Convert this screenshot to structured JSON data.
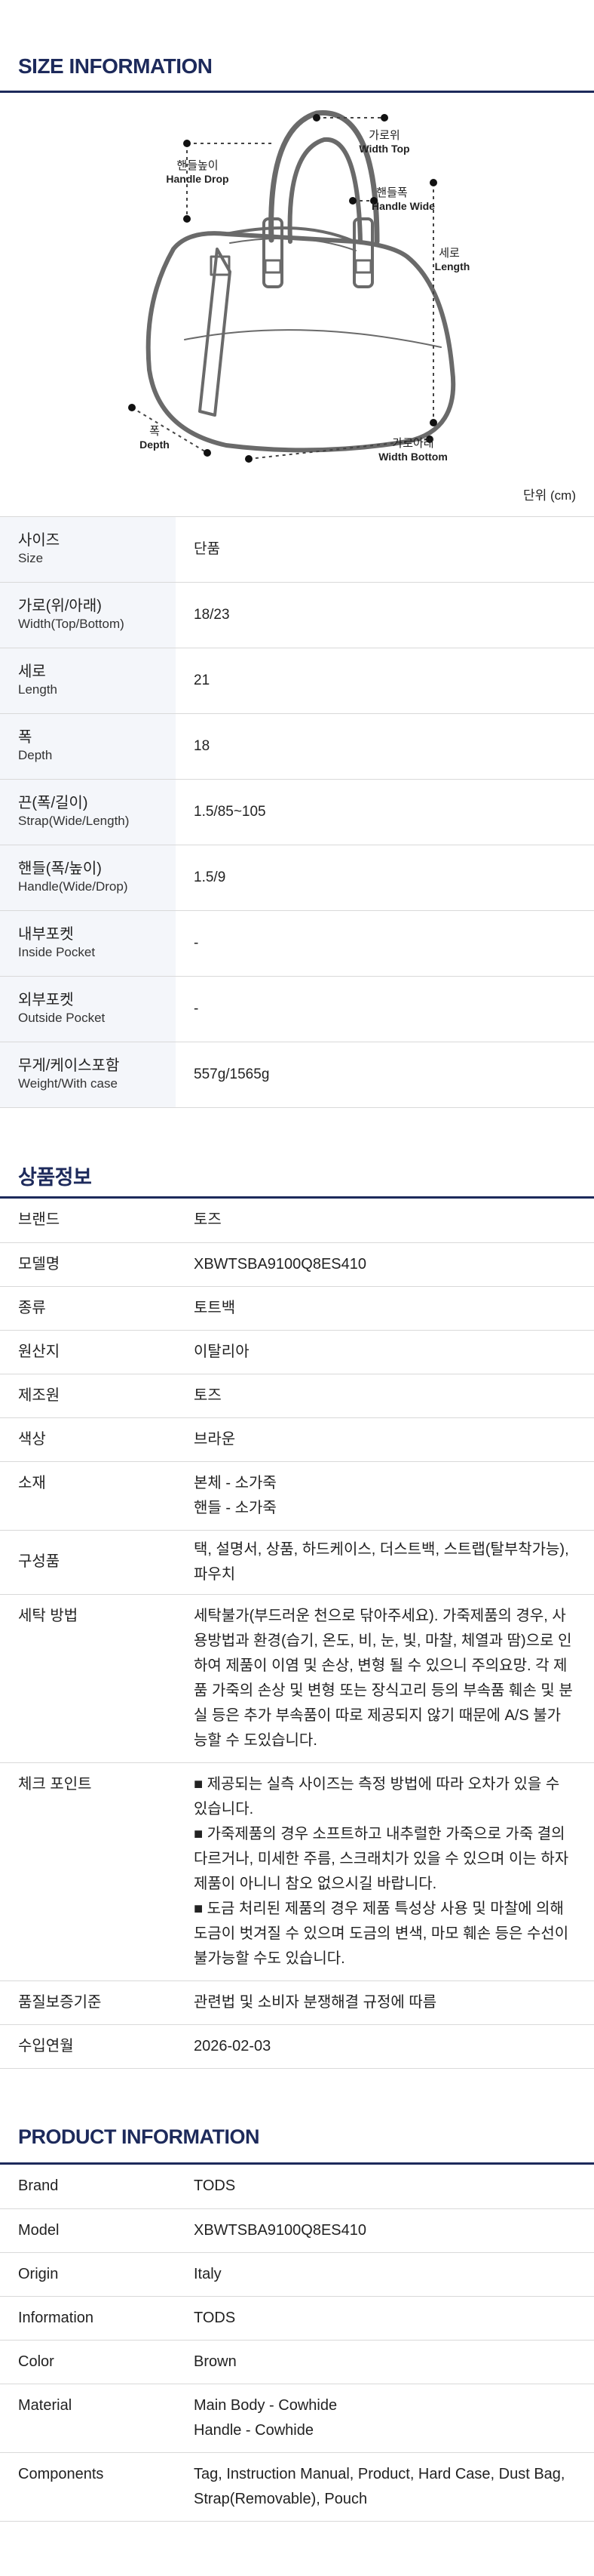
{
  "size_section": {
    "title": "SIZE INFORMATION",
    "unit": "단위 (cm)",
    "diagram_labels": {
      "handle_drop_ko": "핸들높이",
      "handle_drop_en": "Handle Drop",
      "width_top_ko": "가로위",
      "width_top_en": "Width Top",
      "handle_wide_ko": "핸들폭",
      "handle_wide_en": "Handle Wide",
      "length_ko": "세로",
      "length_en": "Length",
      "depth_ko": "폭",
      "depth_en": "Depth",
      "width_bottom_ko": "가로아래",
      "width_bottom_en": "Width Bottom"
    },
    "rows": [
      {
        "ko": "사이즈",
        "en": "Size",
        "value": "단품"
      },
      {
        "ko": "가로(위/아래)",
        "en": "Width(Top/Bottom)",
        "value": "18/23"
      },
      {
        "ko": "세로",
        "en": "Length",
        "value": "21"
      },
      {
        "ko": "폭",
        "en": "Depth",
        "value": "18"
      },
      {
        "ko": "끈(폭/길이)",
        "en": "Strap(Wide/Length)",
        "value": "1.5/85~105"
      },
      {
        "ko": "핸들(폭/높이)",
        "en": "Handle(Wide/Drop)",
        "value": "1.5/9"
      },
      {
        "ko": "내부포켓",
        "en": "Inside Pocket",
        "value": "-"
      },
      {
        "ko": "외부포켓",
        "en": "Outside Pocket",
        "value": "-"
      },
      {
        "ko": "무게/케이스포함",
        "en": "Weight/With case",
        "value": "557g/1565g"
      }
    ]
  },
  "product_ko": {
    "title": "상품정보",
    "rows": [
      {
        "label": "브랜드",
        "value": [
          "토즈"
        ]
      },
      {
        "label": "모델명",
        "value": [
          "XBWTSBA9100Q8ES410"
        ]
      },
      {
        "label": "종류",
        "value": [
          "토트백"
        ]
      },
      {
        "label": "원산지",
        "value": [
          "이탈리아"
        ]
      },
      {
        "label": "제조원",
        "value": [
          "토즈"
        ]
      },
      {
        "label": "색상",
        "value": [
          "브라운"
        ]
      },
      {
        "label": "소재",
        "value": [
          "본체 - 소가죽",
          "핸들 - 소가죽"
        ]
      },
      {
        "label": "구성품",
        "value": [
          "택, 설명서, 상품, 하드케이스, 더스트백, 스트랩(탈부착가능), 파우치"
        ]
      },
      {
        "label": "세탁 방법",
        "value": [
          "세탁불가(부드러운 천으로 닦아주세요). 가죽제품의 경우, 사용방법과 환경(습기, 온도, 비, 눈, 빛, 마찰, 체열과 땀)으로 인하여 제품이 이염 및 손상, 변형 될 수 있으니 주의요망. 각 제품 가죽의 손상 및 변형 또는 장식고리 등의 부속품 훼손 및 분실 등은 추가 부속품이 따로 제공되지 않기 때문에 A/S 불가능할 수 도있습니다."
        ]
      },
      {
        "label": "체크 포인트",
        "value": [
          "■ 제공되는 실측 사이즈는 측정 방법에 따라 오차가 있을 수 있습니다.",
          "■ 가죽제품의 경우 소프트하고 내추럴한 가죽으로 가죽 결의 다르거나, 미세한 주름, 스크래치가 있을 수 있으며 이는 하자제품이 아니니 참오 없으시길 바랍니다.",
          "■ 도금 처리된 제품의 경우 제품 특성상 사용 및 마찰에 의해 도금이 벗겨질 수 있으며 도금의 변색, 마모 훼손 등은 수선이 불가능할 수도 있습니다."
        ]
      },
      {
        "label": "품질보증기준",
        "value": [
          "관련법 및 소비자 분쟁해결 규정에 따름"
        ]
      },
      {
        "label": "수입연월",
        "value": [
          "2026-02-03"
        ]
      }
    ]
  },
  "product_en": {
    "title": "PRODUCT INFORMATION",
    "rows": [
      {
        "label": "Brand",
        "value": [
          "TODS"
        ]
      },
      {
        "label": "Model",
        "value": [
          "XBWTSBA9100Q8ES410"
        ]
      },
      {
        "label": "Origin",
        "value": [
          "Italy"
        ]
      },
      {
        "label": "Information",
        "value": [
          "TODS"
        ]
      },
      {
        "label": "Color",
        "value": [
          "Brown"
        ]
      },
      {
        "label": "Material",
        "value": [
          "Main Body - Cowhide",
          "Handle - Cowhide"
        ]
      },
      {
        "label": "Components",
        "value": [
          "Tag, Instruction Manual, Product, Hard Case, Dust Bag, Strap(Removable), Pouch"
        ]
      }
    ]
  },
  "colors": {
    "navy": "#1d2a5b",
    "label_bg": "#f4f6fa",
    "divider": "#d9d9d9",
    "bag_stroke": "#6a6a6a"
  }
}
